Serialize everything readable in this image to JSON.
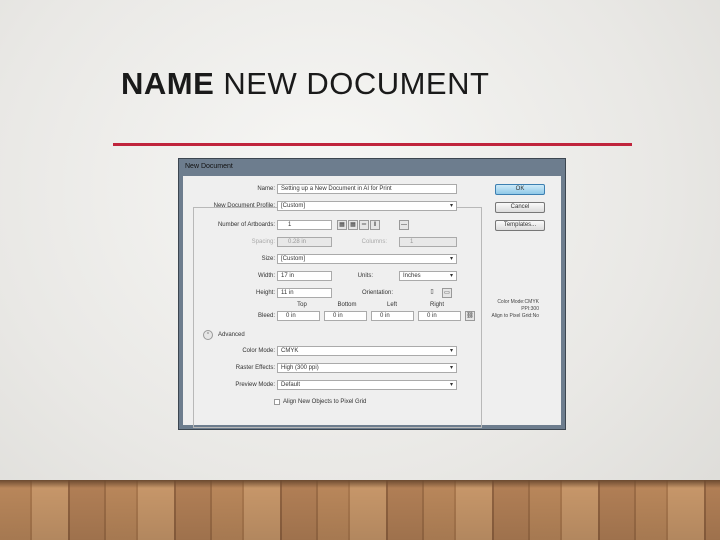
{
  "slide": {
    "title_bold": "NAME",
    "title_rest": " NEW DOCUMENT"
  },
  "dialog": {
    "title": "New Document",
    "name_label": "Name:",
    "name_value": "Setting up a New Document in AI for Print",
    "profile_label": "New Document Profile:",
    "profile_value": "[Custom]",
    "artboards_label": "Number of Artboards:",
    "artboards_value": "1",
    "spacing_label": "Spacing:",
    "spacing_value": "0.28 in",
    "columns_label": "Columns:",
    "columns_value": "1",
    "size_label": "Size:",
    "size_value": "[Custom]",
    "width_label": "Width:",
    "width_value": "17 in",
    "units_label": "Units:",
    "units_value": "Inches",
    "height_label": "Height:",
    "height_value": "11 in",
    "orientation_label": "Orientation:",
    "bleed_label": "Bleed:",
    "bleed": [
      {
        "label": "Top",
        "value": "0 in"
      },
      {
        "label": "Bottom",
        "value": "0 in"
      },
      {
        "label": "Left",
        "value": "0 in"
      },
      {
        "label": "Right",
        "value": "0 in"
      }
    ],
    "advanced_label": "Advanced",
    "color_mode_label": "Color Mode:",
    "color_mode_value": "CMYK",
    "raster_label": "Raster Effects:",
    "raster_value": "High (300 ppi)",
    "preview_label": "Preview Mode:",
    "preview_value": "Default",
    "align_label": "Align New Objects to Pixel Grid",
    "ok": "OK",
    "cancel": "Cancel",
    "templates": "Templates...",
    "info": [
      "Color Mode:CMYK",
      "PPI:300",
      "Align to Pixel Grid:No"
    ]
  }
}
